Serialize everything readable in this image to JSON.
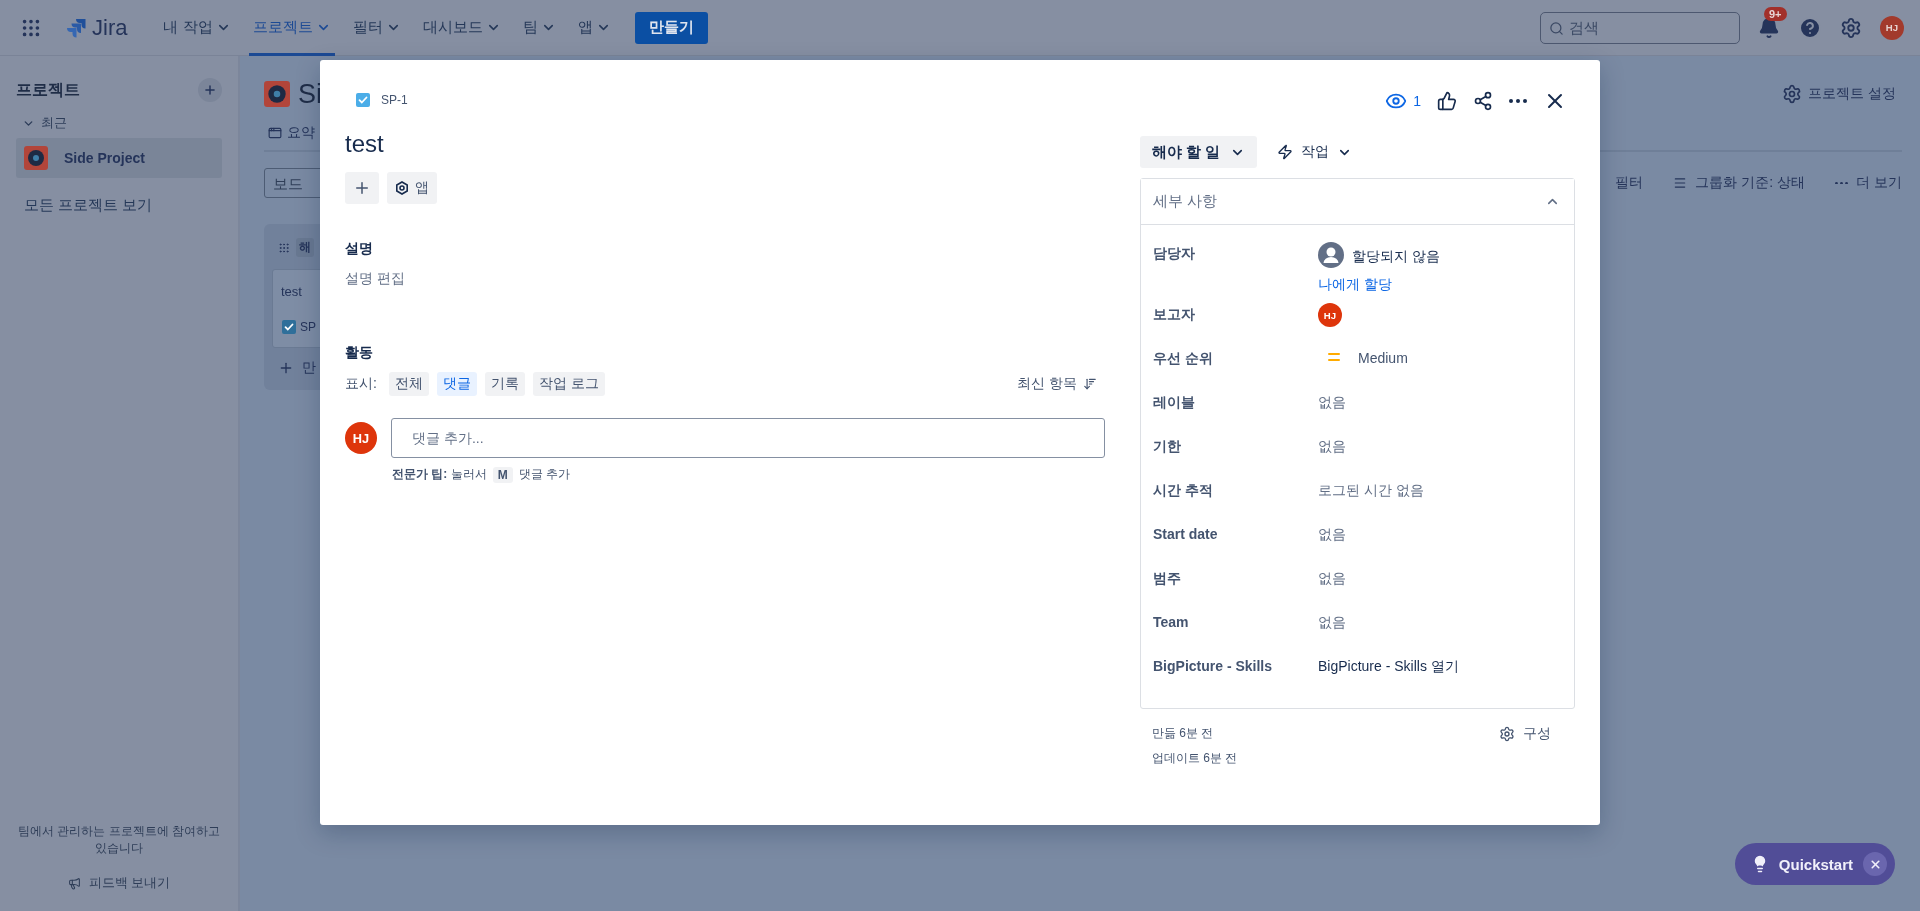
{
  "top_nav": {
    "product": "Jira",
    "menus": [
      {
        "label": "내 작업",
        "selected": false
      },
      {
        "label": "프로젝트",
        "selected": true
      },
      {
        "label": "필터",
        "selected": false
      },
      {
        "label": "대시보드",
        "selected": false
      },
      {
        "label": "팀",
        "selected": false
      },
      {
        "label": "앱",
        "selected": false
      }
    ],
    "create_button": "만들기",
    "search": {
      "placeholder": "검색"
    },
    "notification_badge": "9+",
    "avatar": "HJ"
  },
  "sidebar": {
    "title": "프로젝트",
    "section": "최근",
    "projects": [
      {
        "name": "Side Project",
        "selected": true
      }
    ],
    "all_projects_link": "모든 프로젝트 보기",
    "footer_text": "팀에서 관리하는 프로젝트에 참여하고 있습니다",
    "feedback": "피드백 보내기"
  },
  "board": {
    "title": "Si",
    "tab": "요약",
    "search_placeholder": "보드",
    "settings": "프로젝트 설정",
    "toolbar": [
      {
        "label": "필터",
        "kind": "plain"
      },
      {
        "label": "그룹화 기준: 상태",
        "kind": "group"
      },
      {
        "label": "더 보기",
        "kind": "more"
      }
    ],
    "column_title": "해",
    "card": {
      "title": "test",
      "key": "SP",
      "checked": true
    },
    "create": "만"
  },
  "issue": {
    "key": "SP-1",
    "title": "test",
    "apps_button": "앱",
    "watchers": "1",
    "status": "해야 할 일",
    "actions": "작업",
    "description_heading": "설명",
    "description_placeholder": "설명 편집",
    "activity_heading": "활동",
    "show_label": "표시:",
    "filters": [
      {
        "label": "전체",
        "selected": false
      },
      {
        "label": "댓글",
        "selected": true
      },
      {
        "label": "기록",
        "selected": false
      },
      {
        "label": "작업 로그",
        "selected": false
      }
    ],
    "sort": "최신 항목",
    "comment": {
      "avatar": "HJ",
      "placeholder": "댓글 추가...",
      "tip": "**전문가 팁:** 눌러서",
      "tip_key": "M",
      "tip_after": "댓글 추가"
    },
    "details": {
      "title": "세부 사항",
      "expanded": true,
      "fields": [
        {
          "label": "담당자",
          "kind": "assignee",
          "value": "할당되지 않음",
          "link": "나에게 할당"
        },
        {
          "label": "보고자",
          "kind": "avatar",
          "value": "HJ"
        },
        {
          "label": "우선 순위",
          "kind": "priority",
          "value": "Medium"
        },
        {
          "label": "레이블",
          "kind": "text",
          "value": "없음"
        },
        {
          "label": "기한",
          "kind": "text",
          "value": "없음"
        },
        {
          "label": "시간 추적",
          "kind": "text",
          "value": "로그된 시간 없음"
        },
        {
          "label": "Start date",
          "kind": "text",
          "value": "없음"
        },
        {
          "label": "범주",
          "kind": "text",
          "value": "없음"
        },
        {
          "label": "Team",
          "kind": "text",
          "value": "없음"
        },
        {
          "label": "BigPicture - Skills",
          "kind": "strong",
          "value": "BigPicture - Skills 열기"
        }
      ]
    },
    "created": "만듦 6분 전",
    "updated": "업데이트 6분 전",
    "configure": "구성"
  },
  "quickstart": "Quickstart"
}
